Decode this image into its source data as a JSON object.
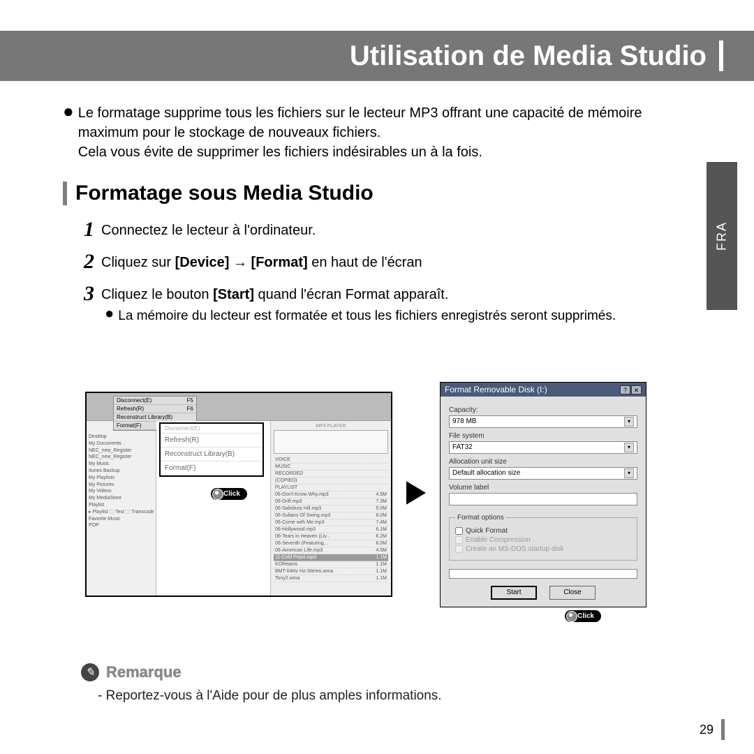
{
  "header": {
    "title": "Utilisation de Media Studio"
  },
  "side_tab": "FRA",
  "intro": {
    "line1": "Le formatage supprime tous les fichiers sur le lecteur MP3 offrant une capacité de mémoire maximum pour le stockage de nouveaux fichiers.",
    "line2": "Cela vous évite de supprimer les fichiers indésirables un à la fois."
  },
  "section_title": "Formatage sous Media Studio",
  "steps": {
    "s1": "Connectez le lecteur à l'ordinateur.",
    "s2_pre": "Cliquez sur ",
    "s2_b1": "[Device]",
    "s2_mid": " → ",
    "s2_b2": "[Format]",
    "s2_post": " en haut de l'écran",
    "s3_pre": "Cliquez le bouton ",
    "s3_b1": "[Start]",
    "s3_post": " quand l'écran Format apparaît.",
    "s3_sub": "La mémoire du lecteur est formatée et tous les fichiers enregistrés seront supprimés."
  },
  "media_window": {
    "menu": [
      {
        "l": "Disconnect(E)",
        "r": "F5"
      },
      {
        "l": "Refresh(R)",
        "r": "F6"
      },
      {
        "l": "Reconstruct Library(B)",
        "r": ""
      },
      {
        "l": "Format(F)",
        "r": ""
      }
    ],
    "dropdown": {
      "top": "Disconnect(E)",
      "items": [
        "Refresh(R)",
        "Reconstruct Library(B)",
        "Format(F)"
      ]
    },
    "tree": [
      "Desktop",
      "My Documents",
      " NEC_new_Register",
      " NEC_new_Register",
      " My Music",
      "  Itunes Backup",
      "  My Playlists",
      " My Pictures",
      " My Videos",
      " My MediaStore",
      "Playlist",
      "▸ Playlist ⬚ Test ⬚ Transcode",
      "Favorite Music",
      " POP"
    ],
    "right_label": "MP3 PLAYER",
    "files": [
      {
        "n": "VOICE",
        "s": ""
      },
      {
        "n": "MUSIC",
        "s": ""
      },
      {
        "n": "RECORDED",
        "s": ""
      },
      {
        "n": "(COPIED)",
        "s": ""
      },
      {
        "n": "PLAYLIST",
        "s": ""
      },
      {
        "n": "06-Don't Know Why.mp3",
        "s": "4.5M"
      },
      {
        "n": "06-Drift.mp3",
        "s": "7.3M"
      },
      {
        "n": "06-Salisbury Hill.mp3",
        "s": "5.0M"
      },
      {
        "n": "06-Sultans Of Swing.mp3",
        "s": "8.0M"
      },
      {
        "n": "06-Come with Me.mp3",
        "s": "7.4M"
      },
      {
        "n": "06-Hollywood.mp3",
        "s": "6.1M"
      },
      {
        "n": "06-Tears in Heaven (Liv...",
        "s": "6.2M"
      },
      {
        "n": "06-Seventh (Featuring...",
        "s": "6.0M"
      },
      {
        "n": "06-American Life.mp3",
        "s": "4.5M"
      },
      {
        "n": "11-Cold Pepsi.mp3",
        "s": "1.1M",
        "sel": true
      },
      {
        "n": "KOReams",
        "s": "1.1M"
      },
      {
        "n": "BMT-04Hz Hz-Stereo.wma",
        "s": "1.1M"
      },
      {
        "n": "Tony2.wma",
        "s": "1.1M"
      }
    ],
    "click": "Click"
  },
  "dialog": {
    "title": "Format Removable Disk (I:)",
    "capacity_label": "Capacity:",
    "capacity": "978 MB",
    "filesystem_label": "File system",
    "filesystem": "FAT32",
    "alloc_label": "Allocation unit size",
    "alloc": "Default allocation size",
    "volume_label": "Volume label",
    "volume": "",
    "options_legend": "Format options",
    "opt_quick": "Quick Format",
    "opt_compress": "Enable Compression",
    "opt_msdos": "Create an MS-DOS startup disk",
    "btn_start": "Start",
    "btn_close": "Close",
    "click": "Click"
  },
  "note": {
    "label": "Remarque",
    "text": "- Reportez-vous à l'Aide pour de plus amples informations."
  },
  "page_number": "29"
}
